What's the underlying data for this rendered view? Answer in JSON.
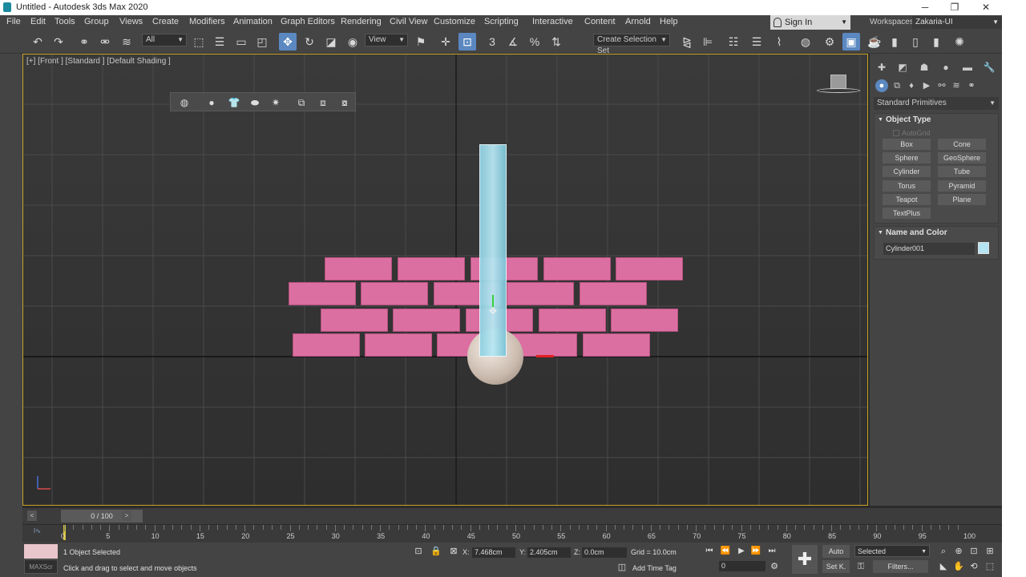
{
  "window": {
    "title": "Untitled - Autodesk 3ds Max 2020",
    "minimize": "─",
    "maximize": "❐",
    "close": "✕"
  },
  "menu": [
    "File",
    "Edit",
    "Tools",
    "Group",
    "Views",
    "Create",
    "Modifiers",
    "Animation",
    "Graph Editors",
    "Rendering",
    "Civil View",
    "Customize",
    "Scripting",
    "Interactive",
    "Content",
    "Arnold",
    "Help"
  ],
  "account": {
    "sign_in": "Sign In",
    "workspaces_label": "Workspaces:",
    "workspace": "Zakaria-UI"
  },
  "toolbar": {
    "selection_filter": "All",
    "ref_coord": "View",
    "snap_count": "3",
    "create_selection_set": "Create Selection Set"
  },
  "viewport": {
    "label": "[+] [Front ] [Standard ] [Default Shading ]"
  },
  "command_panel": {
    "category": "Standard Primitives",
    "object_type_title": "Object Type",
    "autogrid": "AutoGrid",
    "primitives": [
      "Box",
      "Cone",
      "Sphere",
      "GeoSphere",
      "Cylinder",
      "Tube",
      "Torus",
      "Pyramid",
      "Teapot",
      "Plane",
      "TextPlus"
    ],
    "name_color_title": "Name and Color",
    "object_name": "Cylinder001",
    "object_color": "#b5e4f2"
  },
  "time": {
    "frame_display": "0 / 100",
    "ticks": [
      "0",
      "5",
      "10",
      "15",
      "20",
      "25",
      "30",
      "35",
      "40",
      "45",
      "50",
      "55",
      "60",
      "65",
      "70",
      "75",
      "80",
      "85",
      "90",
      "95",
      "100"
    ]
  },
  "status": {
    "selection": "1 Object Selected",
    "prompt": "Click and drag to select and move objects",
    "x_label": "X:",
    "x": "7.468cm",
    "y_label": "Y:",
    "y": "2.405cm",
    "z_label": "Z:",
    "z": "0.0cm",
    "grid": "Grid = 10.0cm",
    "add_time_tag": "Add Time Tag",
    "auto_key": "Auto",
    "set_key": "Set K.",
    "key_filter": "Selected",
    "filters": "Filters...",
    "frame": "0",
    "maxscript": "MAXScr"
  },
  "colors": {
    "brick": "#dc6fa1",
    "cylinder": "#8fd0e0",
    "accent": "#5b88c0",
    "viewport_border": "#c9a227"
  }
}
